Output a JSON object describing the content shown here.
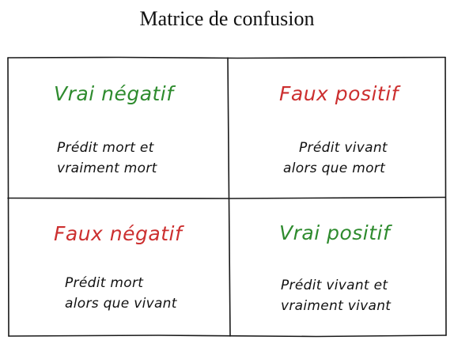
{
  "title": "Matrice de confusion",
  "colors": {
    "true_label": "#2e8b2e",
    "false_label": "#cc2f2f",
    "grid_line": "#1a1a1a"
  },
  "cells": [
    {
      "label": "Vrai négatif",
      "kind": "true",
      "description_lines": [
        "Prédit mort et",
        "vraiment mort"
      ]
    },
    {
      "label": "Faux positif",
      "kind": "false",
      "description_lines": [
        "Prédit vivant",
        "alors que mort"
      ]
    },
    {
      "label": "Faux négatif",
      "kind": "false",
      "description_lines": [
        "Prédit mort",
        "alors que vivant"
      ]
    },
    {
      "label": "Vrai positif",
      "kind": "true",
      "description_lines": [
        "Prédit vivant et",
        "vraiment vivant"
      ]
    }
  ]
}
